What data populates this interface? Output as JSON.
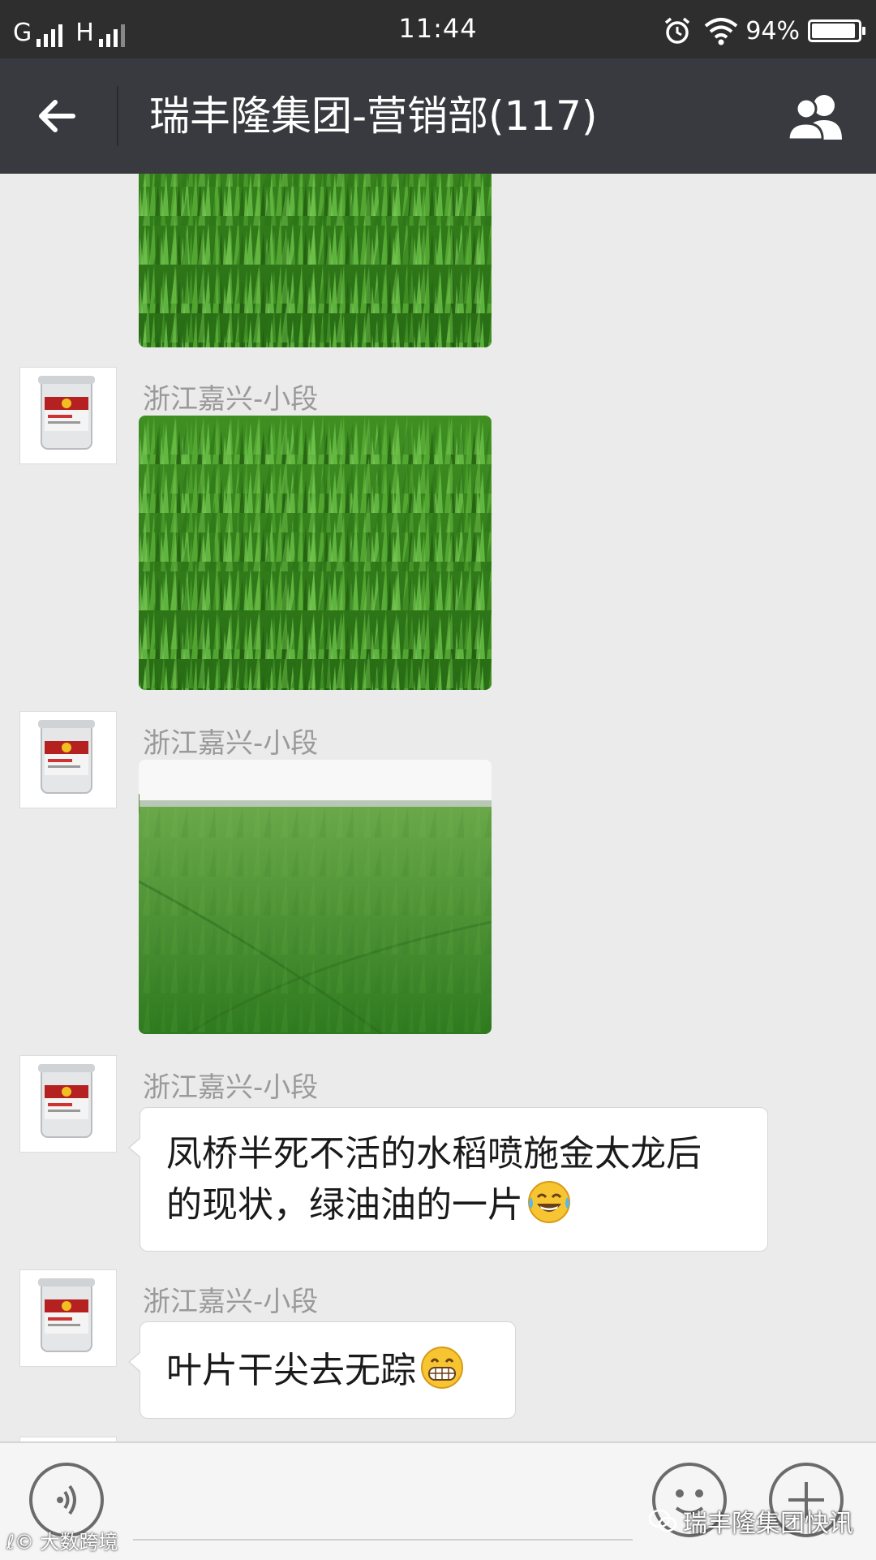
{
  "status_bar": {
    "network_1": "G",
    "network_2": "H",
    "time": "11:44",
    "battery_percent": "94%",
    "battery_level": 0.94,
    "icons": [
      "signal-icon",
      "alarm-icon",
      "wifi-icon",
      "battery-icon"
    ]
  },
  "header": {
    "title": "瑞丰隆集团-营销部(117)",
    "back_icon": "back-arrow-icon",
    "members_icon": "group-members-icon",
    "background": "#393a3f"
  },
  "messages": [
    {
      "type": "image",
      "sender": "",
      "image": "rice-field-closeup"
    },
    {
      "type": "image",
      "sender": "浙江嘉兴-小段",
      "image": "rice-field-closeup"
    },
    {
      "type": "image",
      "sender": "浙江嘉兴-小段",
      "image": "rice-field-wide"
    },
    {
      "type": "text",
      "sender": "浙江嘉兴-小段",
      "line1": "凤桥半死不活的水稻喷施金太龙后",
      "line2": "的现状，绿油油的一片",
      "emoji": "tears-of-joy-emoji"
    },
    {
      "type": "text",
      "sender": "浙江嘉兴-小段",
      "line1": "叶片干尖去无踪",
      "emoji": "grinning-emoji"
    }
  ],
  "input_bar": {
    "voice_icon": "voice-icon",
    "emoji_icon": "emoji-icon",
    "plus_icon": "plus-icon"
  },
  "watermarks": {
    "left": "大数跨境",
    "right": "瑞丰隆集团快讯"
  },
  "colors": {
    "chat_background": "#ebebeb",
    "bubble": "#ffffff",
    "sender_name": "#9a9a9a"
  }
}
